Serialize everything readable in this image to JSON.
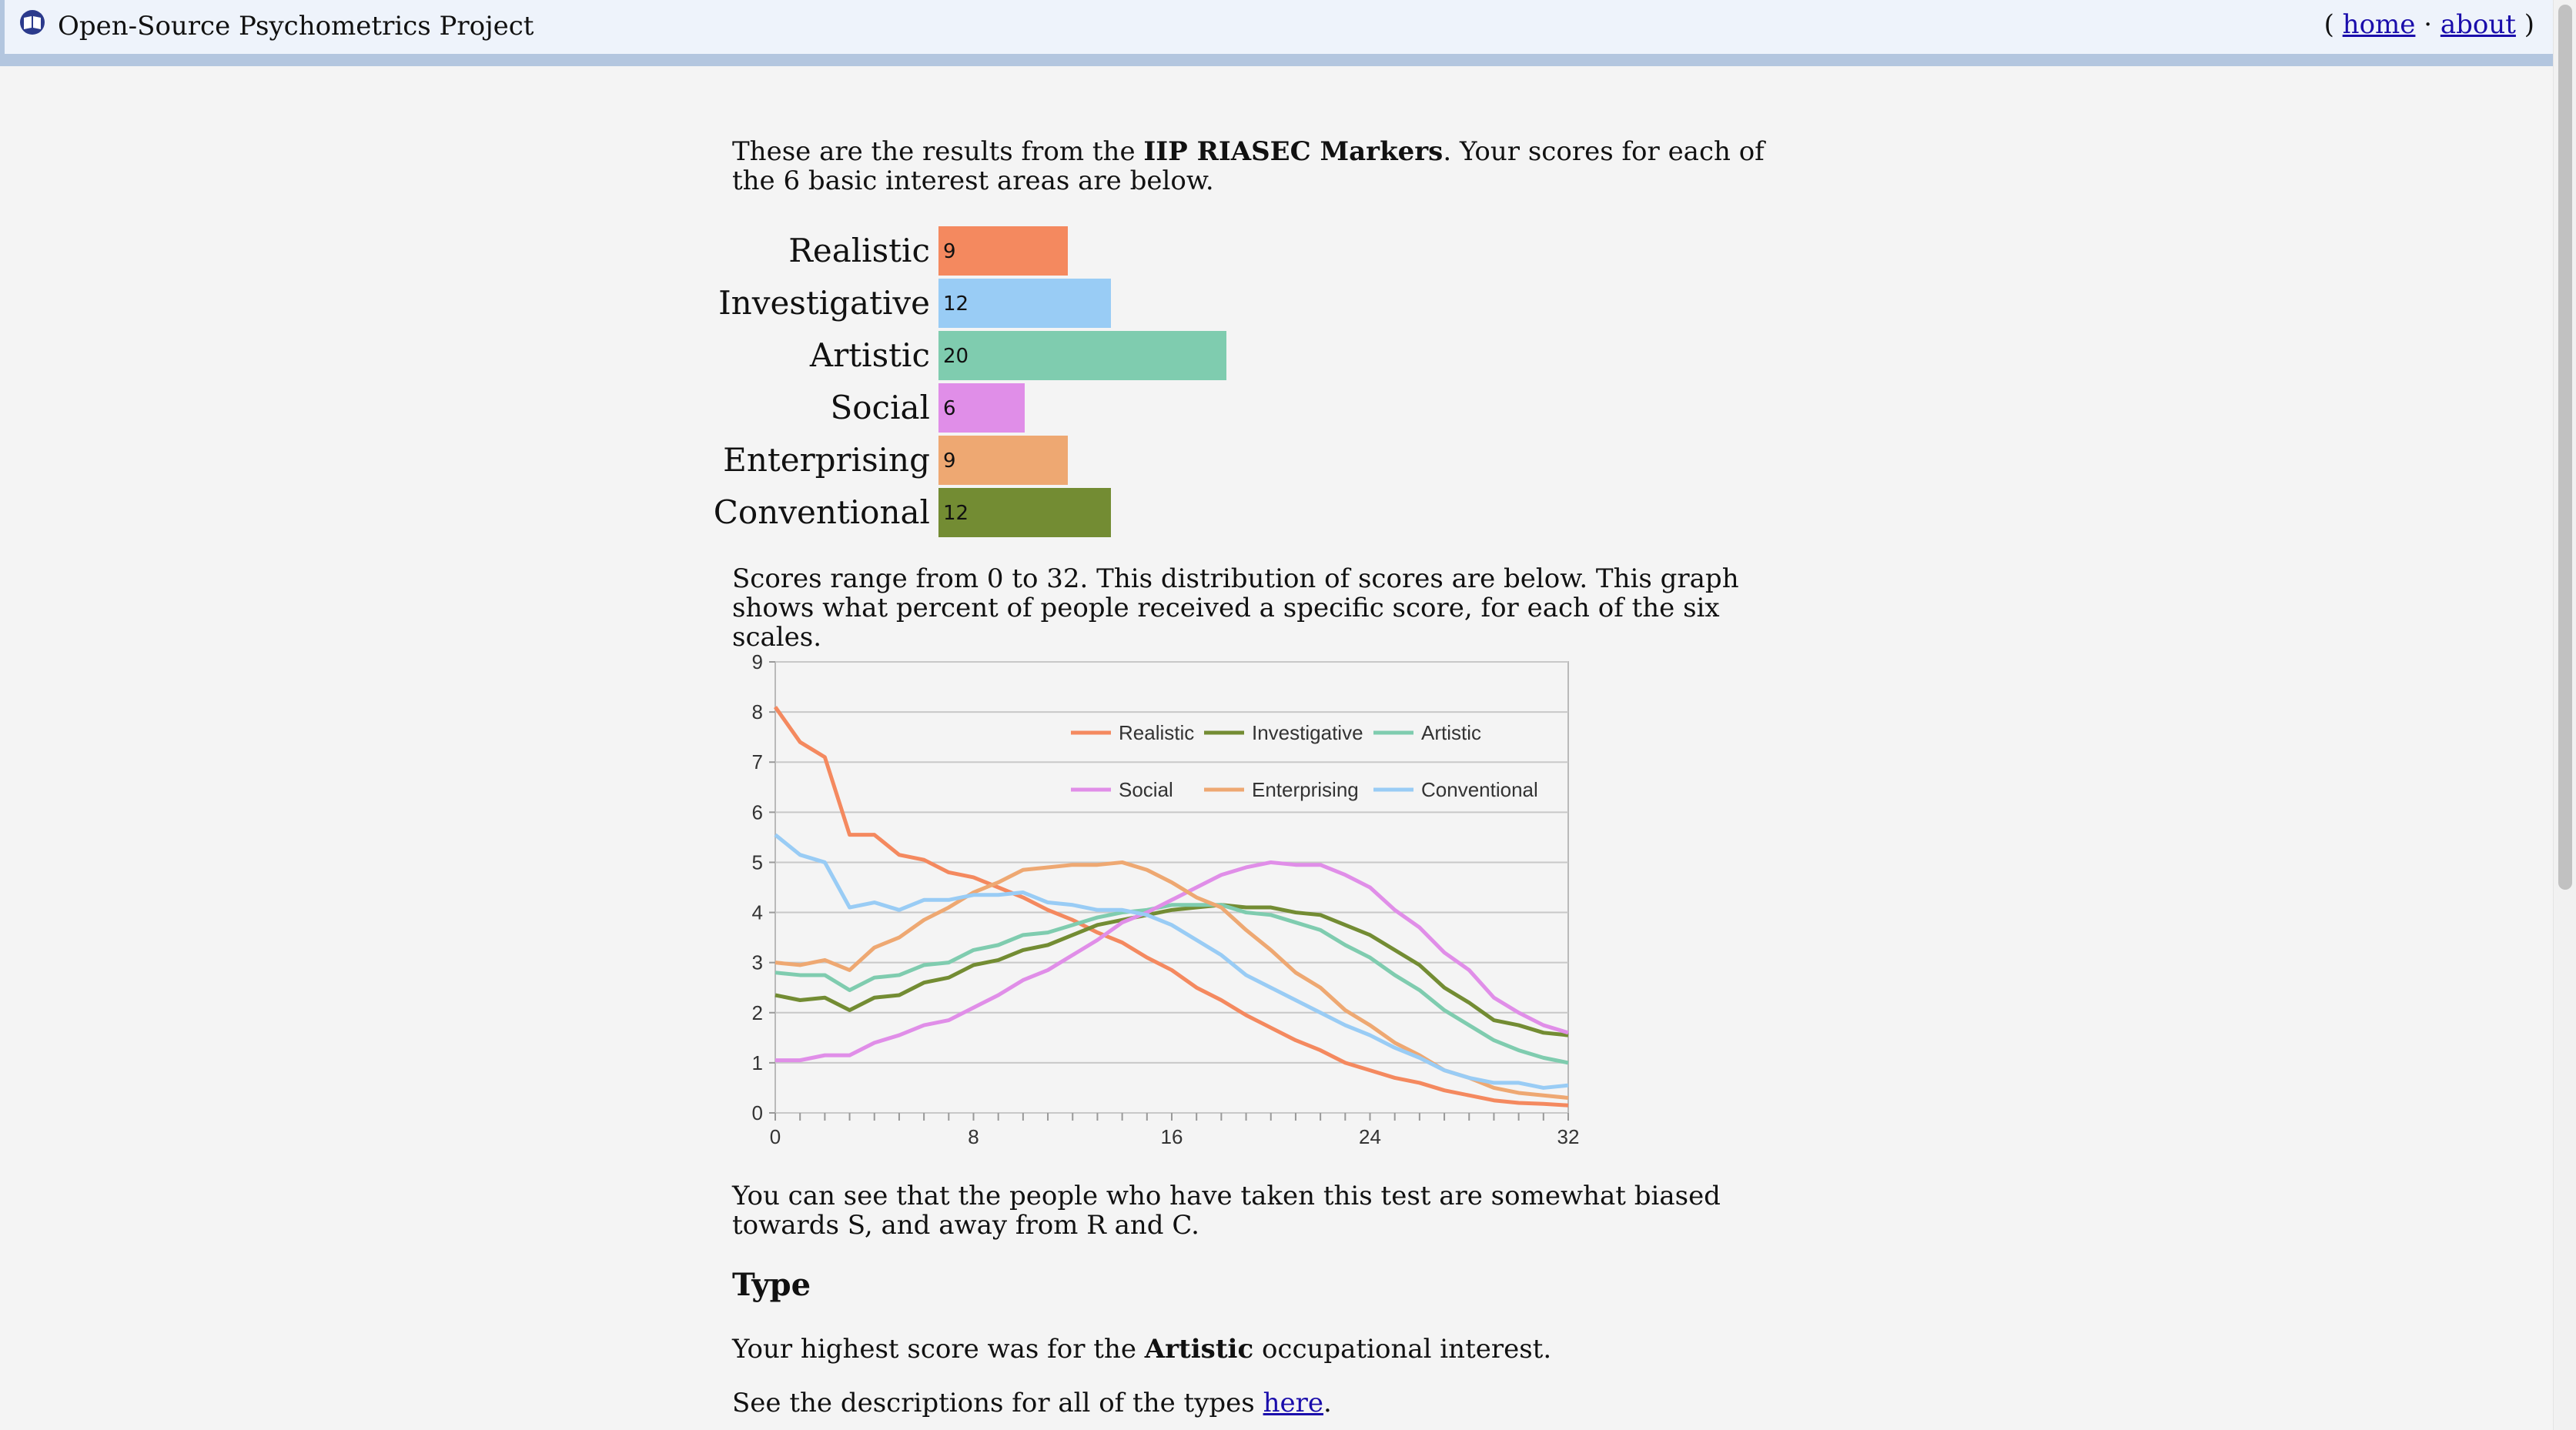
{
  "header": {
    "site_title": "Open-Source Psychometrics Project",
    "nav_open": "(",
    "nav_home": "home",
    "nav_sep": "·",
    "nav_about": "about",
    "nav_close": ")"
  },
  "intro": {
    "pre": "These are the results from the ",
    "test_name": "IIP RIASEC Markers",
    "post": ". Your scores for each of the 6 basic interest areas are below."
  },
  "scores": [
    {
      "label": "Realistic",
      "value": 9,
      "display": "9",
      "color": "#f4895f"
    },
    {
      "label": "Investigative",
      "value": 12,
      "display": "12",
      "color": "#99ccf5"
    },
    {
      "label": "Artistic",
      "value": 20,
      "display": "20",
      "color": "#7fccaf"
    },
    {
      "label": "Social",
      "value": 6,
      "display": "6",
      "color": "#e08ee8"
    },
    {
      "label": "Enterprising",
      "value": 9,
      "display": "9",
      "color": "#eea872"
    },
    {
      "label": "Conventional",
      "value": 12,
      "display": "12",
      "color": "#738c33"
    }
  ],
  "range_text": "Scores range from 0 to 32. This distribution of scores are below. This graph shows what percent of people received a specific score, for each of the six scales.",
  "chart_data": {
    "type": "line",
    "x": [
      0,
      1,
      2,
      3,
      4,
      5,
      6,
      7,
      8,
      9,
      10,
      11,
      12,
      13,
      14,
      15,
      16,
      17,
      18,
      19,
      20,
      21,
      22,
      23,
      24,
      25,
      26,
      27,
      28,
      29,
      30,
      31,
      32
    ],
    "xticks": [
      "0",
      "8",
      "16",
      "24",
      "32"
    ],
    "yticks": [
      "0",
      "1",
      "2",
      "3",
      "4",
      "5",
      "6",
      "7",
      "8",
      "9"
    ],
    "xlim": [
      0,
      32
    ],
    "ylim": [
      0,
      9
    ],
    "grid": true,
    "legend_position": "top-right",
    "series": [
      {
        "name": "Realistic",
        "color": "#f4895f",
        "values": [
          8.1,
          7.4,
          7.1,
          5.55,
          5.55,
          5.15,
          5.05,
          4.8,
          4.7,
          4.5,
          4.3,
          4.05,
          3.85,
          3.6,
          3.4,
          3.1,
          2.85,
          2.5,
          2.25,
          1.95,
          1.7,
          1.45,
          1.25,
          1.0,
          0.85,
          0.7,
          0.6,
          0.45,
          0.35,
          0.25,
          0.2,
          0.18,
          0.15
        ]
      },
      {
        "name": "Investigative",
        "color": "#738c33",
        "values": [
          2.35,
          2.25,
          2.3,
          2.05,
          2.3,
          2.35,
          2.6,
          2.7,
          2.95,
          3.05,
          3.25,
          3.35,
          3.55,
          3.75,
          3.85,
          3.95,
          4.05,
          4.1,
          4.15,
          4.1,
          4.1,
          4.0,
          3.95,
          3.75,
          3.55,
          3.25,
          2.95,
          2.5,
          2.2,
          1.85,
          1.75,
          1.6,
          1.55
        ]
      },
      {
        "name": "Artistic",
        "color": "#7fccaf",
        "values": [
          2.8,
          2.75,
          2.75,
          2.45,
          2.7,
          2.75,
          2.95,
          3.0,
          3.25,
          3.35,
          3.55,
          3.6,
          3.75,
          3.9,
          4.0,
          4.05,
          4.15,
          4.15,
          4.15,
          4.0,
          3.95,
          3.8,
          3.65,
          3.35,
          3.1,
          2.75,
          2.45,
          2.05,
          1.75,
          1.45,
          1.25,
          1.1,
          1.0
        ]
      },
      {
        "name": "Social",
        "color": "#e08ee8",
        "values": [
          1.05,
          1.05,
          1.15,
          1.15,
          1.4,
          1.55,
          1.75,
          1.85,
          2.1,
          2.35,
          2.65,
          2.85,
          3.15,
          3.45,
          3.8,
          4.0,
          4.25,
          4.5,
          4.75,
          4.9,
          5.0,
          4.95,
          4.95,
          4.75,
          4.5,
          4.05,
          3.7,
          3.2,
          2.85,
          2.3,
          2.0,
          1.75,
          1.6
        ]
      },
      {
        "name": "Enterprising",
        "color": "#eea872",
        "values": [
          3.0,
          2.95,
          3.05,
          2.85,
          3.3,
          3.5,
          3.85,
          4.1,
          4.4,
          4.6,
          4.85,
          4.9,
          4.95,
          4.95,
          5.0,
          4.85,
          4.6,
          4.3,
          4.1,
          3.65,
          3.25,
          2.8,
          2.5,
          2.05,
          1.75,
          1.4,
          1.15,
          0.85,
          0.7,
          0.5,
          0.4,
          0.35,
          0.3
        ]
      },
      {
        "name": "Conventional",
        "color": "#99ccf5",
        "values": [
          5.55,
          5.15,
          5.0,
          4.1,
          4.2,
          4.05,
          4.25,
          4.25,
          4.35,
          4.35,
          4.4,
          4.2,
          4.15,
          4.05,
          4.05,
          3.95,
          3.75,
          3.45,
          3.15,
          2.75,
          2.5,
          2.25,
          2.0,
          1.75,
          1.55,
          1.3,
          1.1,
          0.85,
          0.7,
          0.6,
          0.6,
          0.5,
          0.55
        ]
      }
    ]
  },
  "bias_text": "You can see that the people who have taken this test are somewhat biased towards S, and away from R and C.",
  "type_section": {
    "heading": "Type",
    "highest_pre": "Your highest score was for the ",
    "highest_type": "Artistic",
    "highest_post": " occupational interest.",
    "desc_pre": "See the descriptions for all of the types ",
    "desc_link": "here",
    "desc_post": "."
  },
  "colors": {
    "header_bg": "#eef3fb",
    "header_border": "#b3c6df",
    "page_bg": "#f4f4f4",
    "link": "#1a0dab"
  },
  "icons": {
    "site": "book-icon"
  }
}
